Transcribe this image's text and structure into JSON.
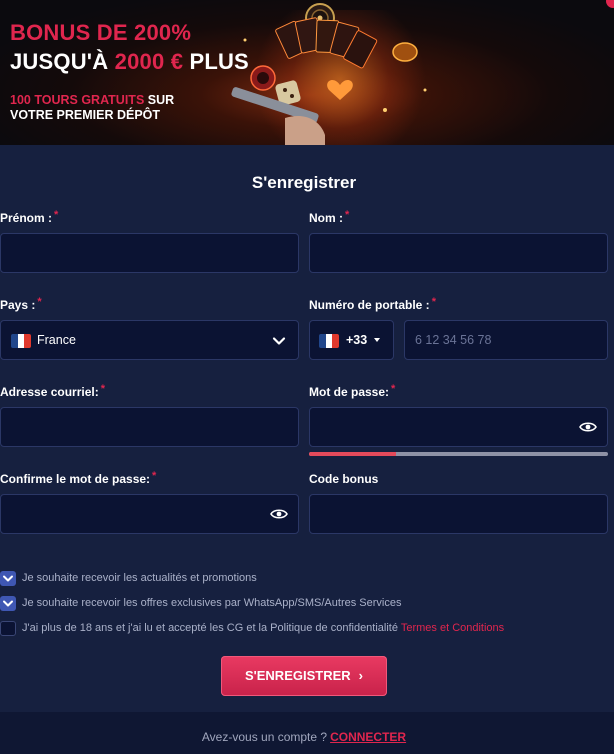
{
  "banner": {
    "line1": "BONUS DE 200%",
    "line2_prefix": "JUSQU'À",
    "line2_highlight": "2000 €",
    "line2_suffix": "PLUS",
    "line3_highlight": "100 TOURS GRATUITS",
    "line3_rest1": "SUR",
    "line3_rest2": "VOTRE PREMIER DÉPÔT"
  },
  "form": {
    "title": "S'enregistrer",
    "required_mark": "*",
    "fields": {
      "prenom": {
        "label": "Prénom :"
      },
      "nom": {
        "label": "Nom :"
      },
      "pays": {
        "label": "Pays :",
        "value": "France"
      },
      "portable": {
        "label": "Numéro de portable :",
        "code": "+33",
        "placeholder": "6 12 34 56 78"
      },
      "email": {
        "label": "Adresse courriel:"
      },
      "password": {
        "label": "Mot de passe:"
      },
      "confirm": {
        "label": "Confirme le mot de passe:"
      },
      "bonus": {
        "label": "Code bonus"
      }
    },
    "password_strength": 0.29,
    "checkboxes": [
      {
        "label": "Je souhaite recevoir les actualités et promotions",
        "checked": true
      },
      {
        "label": "Je souhaite recevoir les offres exclusives par WhatsApp/SMS/Autres Services",
        "checked": true
      },
      {
        "label": "J'ai plus de 18 ans et j'ai lu et accepté les CG et la Politique de confidentialité",
        "link": "Termes et Conditions",
        "checked": false
      }
    ],
    "submit_label": "S'ENREGISTRER",
    "submit_arrow": "›"
  },
  "footer": {
    "text": "Avez-vous un compte ?",
    "link": "CONNECTER"
  },
  "colors": {
    "accent": "#e0264e",
    "background": "#16203f",
    "field": "#0b1333",
    "checkbox": "#3f57b3",
    "flag": [
      "#21468b",
      "#ffffff",
      "#e1392d"
    ]
  },
  "icons": [
    "flag-france-icon",
    "chevron-down-icon",
    "caret-down-icon",
    "eye-icon",
    "check-icon",
    "chevron-right-icon"
  ]
}
